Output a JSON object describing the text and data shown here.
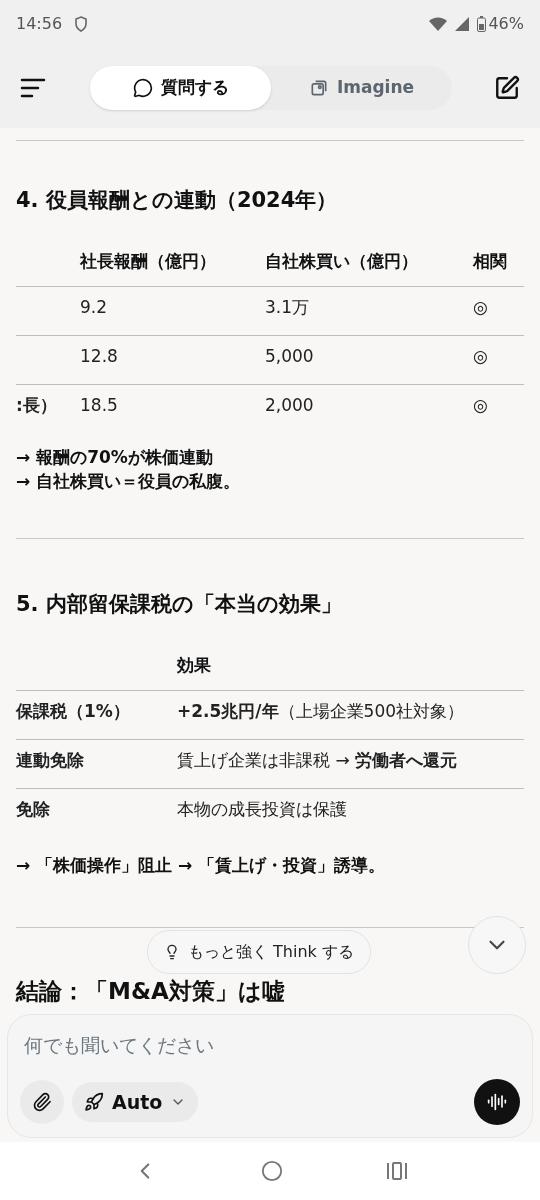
{
  "status_bar": {
    "time": "14:56",
    "battery": "46%"
  },
  "header": {
    "tabs": [
      {
        "label": "質問する",
        "kind": "ask",
        "selected": true
      },
      {
        "label": "Imagine",
        "kind": "imagine",
        "selected": false
      }
    ]
  },
  "sections": [
    {
      "heading": "4. 役員報酬との連動（2024年）",
      "table": {
        "columns": [
          "",
          "社長報酬（億円）",
          "自社株買い（億円）",
          "相関"
        ],
        "rows": [
          [
            "",
            "9.2",
            "3.1万",
            "◎"
          ],
          [
            "",
            "12.8",
            "5,000",
            "◎"
          ],
          [
            ":長）",
            "18.5",
            "2,000",
            "◎"
          ]
        ]
      },
      "notes": [
        "→ 報酬の**70%**が株価連動",
        "→ 自社株買い＝役員の私腹。"
      ]
    },
    {
      "heading": "5. 内部留保課税の「本当の効果」",
      "table": {
        "columns": [
          "",
          "効果"
        ],
        "rows": [
          [
            "保課税（1%）",
            "**+2.5兆円/年**（上場企業500社対象）"
          ],
          [
            "連動免除",
            "賃上げ企業は非課税 → **労働者へ還元**"
          ],
          [
            "免除",
            "本物の成長投資は保護"
          ]
        ]
      },
      "notes": [
        "→ 「**株価操作**」阻止 → 「**賃上げ・投資**」誘導。"
      ]
    }
  ],
  "think_button": "もっと強く Think する",
  "conclusion": "結論：「M&A対策」は嘘",
  "composer": {
    "placeholder": "何でも聞いてください",
    "mode": "Auto"
  }
}
